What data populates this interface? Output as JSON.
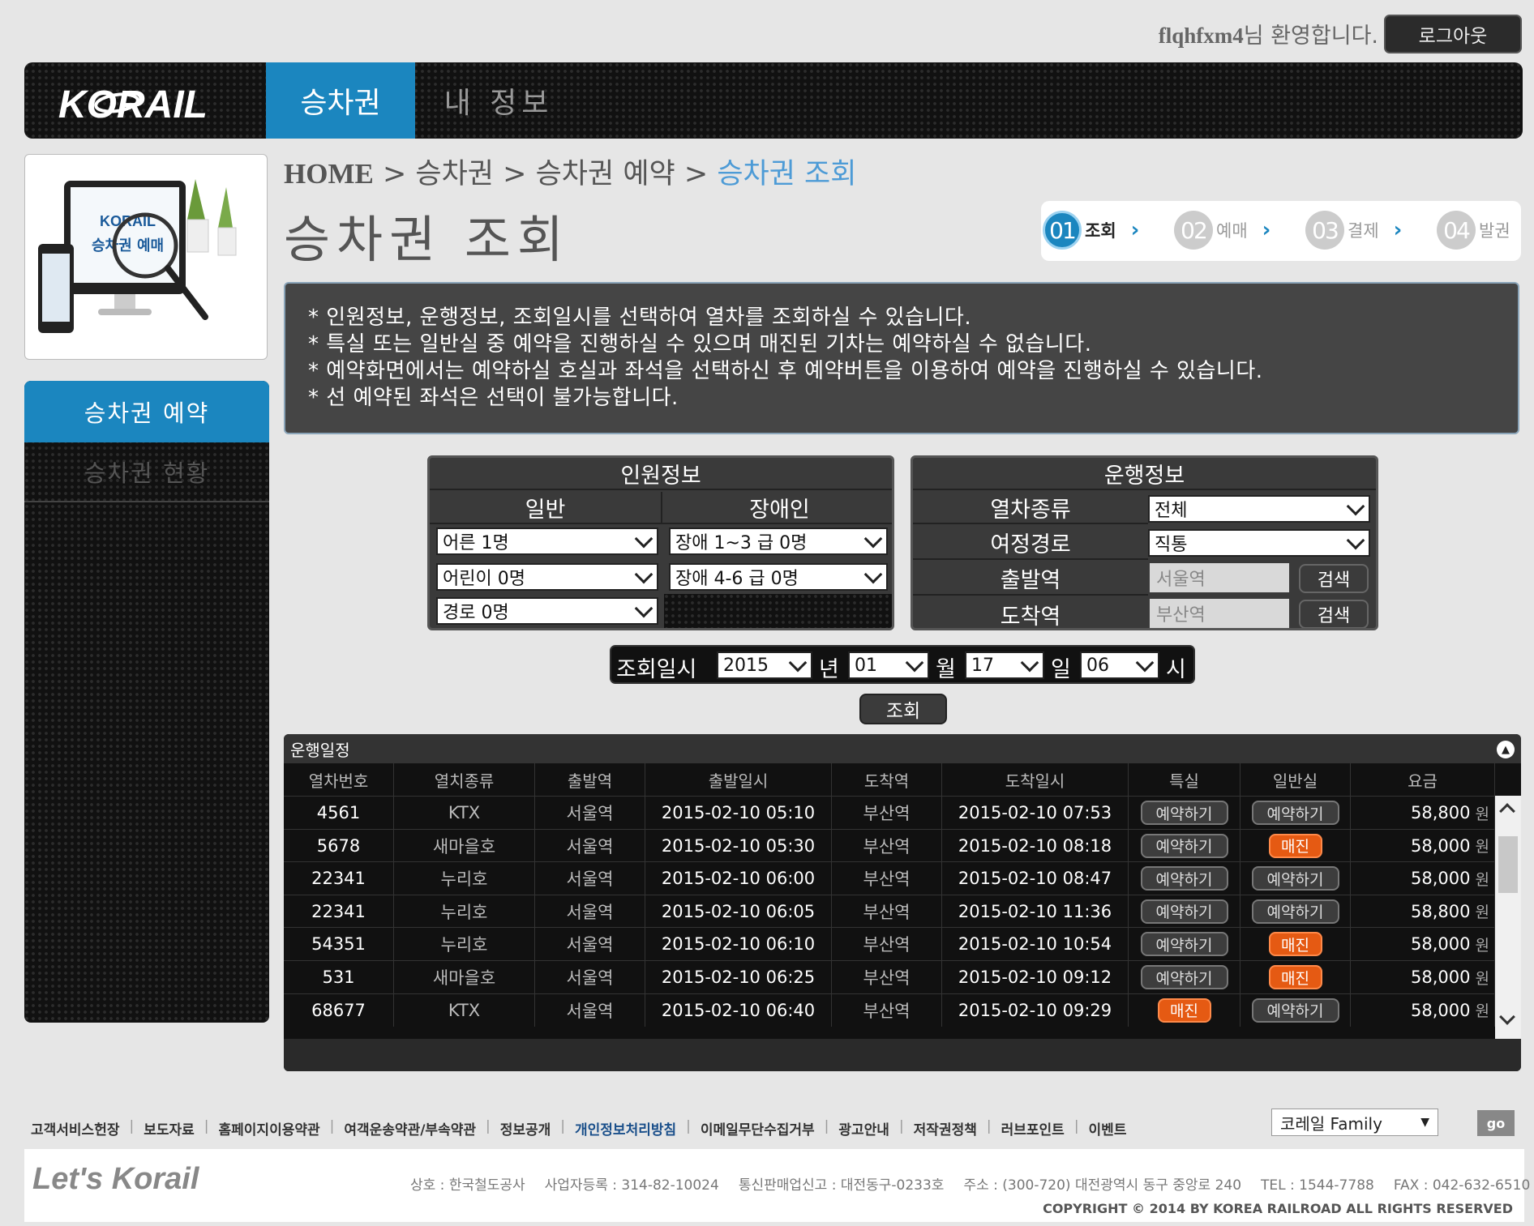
{
  "top": {
    "username": "flqhfxm4",
    "welcome_suffix": "님 환영합니다.",
    "logout_label": "로그아웃"
  },
  "header": {
    "logo_text": "KORAIL",
    "nav_ticket": "승차권",
    "nav_myinfo": "내 정보"
  },
  "promo": {
    "logo": "KORAIL",
    "line": "승차권 예매"
  },
  "sidebar": {
    "items": [
      {
        "label": "승차권 예약"
      },
      {
        "label": "승차권 현황"
      }
    ]
  },
  "breadcrumb": {
    "home": "HOME",
    "sep": " > ",
    "c1": "승차권",
    "c2": "승차권 예약",
    "current": "승차권 조회"
  },
  "page_title": "승차권 조회",
  "steps": [
    {
      "num": "01",
      "label": "조회"
    },
    {
      "num": "02",
      "label": "예매"
    },
    {
      "num": "03",
      "label": "결제"
    },
    {
      "num": "04",
      "label": "발권"
    }
  ],
  "notice": [
    "* 인원정보, 운행정보, 조회일시를 선택하여 열차를 조회하실 수 있습니다.",
    "* 특실 또는 일반실 중 예약을 진행하실 수 있으며 매진된 기차는 예약하실 수 없습니다.",
    "* 예약화면에서는 예약하실 호실과 좌석을 선택하신 후 예약버튼을 이용하여 예약을 진행하실 수 있습니다.",
    "* 선 예약된 좌석은 선택이 불가능합니다."
  ],
  "passenger": {
    "title": "인원정보",
    "general_header": "일반",
    "disabled_header": "장애인",
    "adult": "어른 1명",
    "child": "어린이 0명",
    "senior": "경로 0명",
    "dis13": "장애 1~3 급 0명",
    "dis46": "장애 4-6 급 0명"
  },
  "route": {
    "title": "운행정보",
    "train_type_label": "열차종류",
    "train_type_value": "전체",
    "path_label": "여정경로",
    "path_value": "직통",
    "dep_label": "출발역",
    "dep_placeholder": "서울역",
    "arr_label": "도착역",
    "arr_placeholder": "부산역",
    "search_label": "검색"
  },
  "date": {
    "label": "조회일시",
    "year": "2015",
    "year_unit": "년",
    "month": "01",
    "month_unit": "월",
    "day": "17",
    "day_unit": "일",
    "hour": "06",
    "hour_unit": "시",
    "search_button": "조회"
  },
  "schedule": {
    "title": "운행일정",
    "columns": [
      "열차번호",
      "열치종류",
      "출발역",
      "출발일시",
      "도착역",
      "도착일시",
      "특실",
      "일반실",
      "요금"
    ],
    "won": "원",
    "rows": [
      {
        "no": "4561",
        "type": "KTX",
        "dep": "서울역",
        "dep_time": "2015-02-10 05:10",
        "arr": "부산역",
        "arr_time": "2015-02-10 07:53",
        "special": "예약하기",
        "special_sold": false,
        "general": "예약하기",
        "general_sold": false,
        "fare": "58,800"
      },
      {
        "no": "5678",
        "type": "새마을호",
        "dep": "서울역",
        "dep_time": "2015-02-10 05:30",
        "arr": "부산역",
        "arr_time": "2015-02-10 08:18",
        "special": "예약하기",
        "special_sold": false,
        "general": "매진",
        "general_sold": true,
        "fare": "58,000"
      },
      {
        "no": "22341",
        "type": "누리호",
        "dep": "서울역",
        "dep_time": "2015-02-10 06:00",
        "arr": "부산역",
        "arr_time": "2015-02-10 08:47",
        "special": "예약하기",
        "special_sold": false,
        "general": "예약하기",
        "general_sold": false,
        "fare": "58,000"
      },
      {
        "no": "22341",
        "type": "누리호",
        "dep": "서울역",
        "dep_time": "2015-02-10 06:05",
        "arr": "부산역",
        "arr_time": "2015-02-10 11:36",
        "special": "예약하기",
        "special_sold": false,
        "general": "예약하기",
        "general_sold": false,
        "fare": "58,800"
      },
      {
        "no": "54351",
        "type": "누리호",
        "dep": "서울역",
        "dep_time": "2015-02-10 06:10",
        "arr": "부산역",
        "arr_time": "2015-02-10 10:54",
        "special": "예약하기",
        "special_sold": false,
        "general": "매진",
        "general_sold": true,
        "fare": "58,000"
      },
      {
        "no": "531",
        "type": "새마을호",
        "dep": "서울역",
        "dep_time": "2015-02-10 06:25",
        "arr": "부산역",
        "arr_time": "2015-02-10 09:12",
        "special": "예약하기",
        "special_sold": false,
        "general": "매진",
        "general_sold": true,
        "fare": "58,000"
      },
      {
        "no": "68677",
        "type": "KTX",
        "dep": "서울역",
        "dep_time": "2015-02-10 06:40",
        "arr": "부산역",
        "arr_time": "2015-02-10 09:29",
        "special": "매진",
        "special_sold": true,
        "general": "예약하기",
        "general_sold": false,
        "fare": "58,000"
      }
    ]
  },
  "footer": {
    "links": [
      "고객서비스헌장",
      "보도자료",
      "홈페이지이용약관",
      "여객운송약관/부속약관",
      "정보공개",
      "개인정보처리방침",
      "이메일무단수집거부",
      "광고안내",
      "저작권정책",
      "러브포인트",
      "이벤트"
    ],
    "family_select": "코레일 Family",
    "go_label": "go",
    "brand": "Let's Korail",
    "info": [
      "상호 : 한국철도공사",
      "사업자등록 : 314-82-10024",
      "통신판매업신고 : 대전동구-0233호",
      "주소 : (300-720) 대전광역시 동구 중앙로 240",
      "TEL : 1544-7788",
      "FAX : 042-632-6510"
    ],
    "copyright": "COPYRIGHT © 2014 BY KOREA RAILROAD  ALL RIGHTS RESERVED"
  },
  "colors": {
    "accent": "#1b86bf",
    "sold_out": "#e55a13",
    "breadcrumb_current": "#4d9bd6"
  }
}
